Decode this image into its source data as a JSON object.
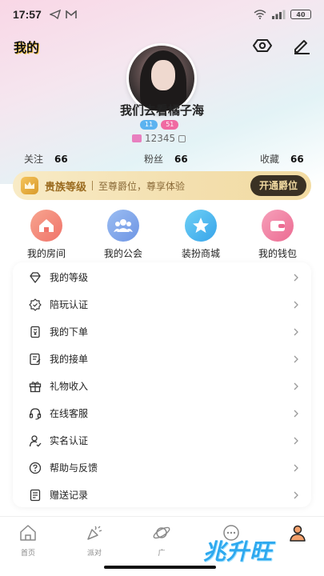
{
  "status_bar": {
    "time": "17:57",
    "battery": "40"
  },
  "header": {
    "title": "我的"
  },
  "profile": {
    "username": "我们去看橘子海",
    "badge_level_a": "11",
    "badge_level_b": "51",
    "user_id": "12345"
  },
  "stats": [
    {
      "label": "关注",
      "value": "66"
    },
    {
      "label": "粉丝",
      "value": "66"
    },
    {
      "label": "收藏",
      "value": "66"
    }
  ],
  "vip": {
    "title": "贵族等级",
    "desc": "至尊爵位，尊享体验",
    "button": "开通爵位"
  },
  "quick_actions": [
    {
      "label": "我的房间",
      "icon": "home-icon",
      "color": "#f48a7a"
    },
    {
      "label": "我的公会",
      "icon": "group-icon",
      "color": "#7fa9ec"
    },
    {
      "label": "装扮商城",
      "icon": "star-icon",
      "color": "#4fb8ef"
    },
    {
      "label": "我的钱包",
      "icon": "wallet-icon",
      "color": "#f08aa8"
    }
  ],
  "menu": [
    {
      "label": "我的等级",
      "icon": "diamond-icon"
    },
    {
      "label": "陪玩认证",
      "icon": "badge-check-icon"
    },
    {
      "label": "我的下单",
      "icon": "order-icon"
    },
    {
      "label": "我的接单",
      "icon": "receive-order-icon"
    },
    {
      "label": "礼物收入",
      "icon": "gift-icon"
    },
    {
      "label": "在线客服",
      "icon": "headset-icon"
    },
    {
      "label": "实名认证",
      "icon": "user-verify-icon"
    },
    {
      "label": "帮助与反馈",
      "icon": "help-icon"
    },
    {
      "label": "赠送记录",
      "icon": "record-icon"
    }
  ],
  "tabs": [
    {
      "label": "首页"
    },
    {
      "label": "派对"
    },
    {
      "label": "广"
    },
    {
      "label": ""
    },
    {
      "label": ""
    }
  ],
  "watermark": "兆升旺"
}
